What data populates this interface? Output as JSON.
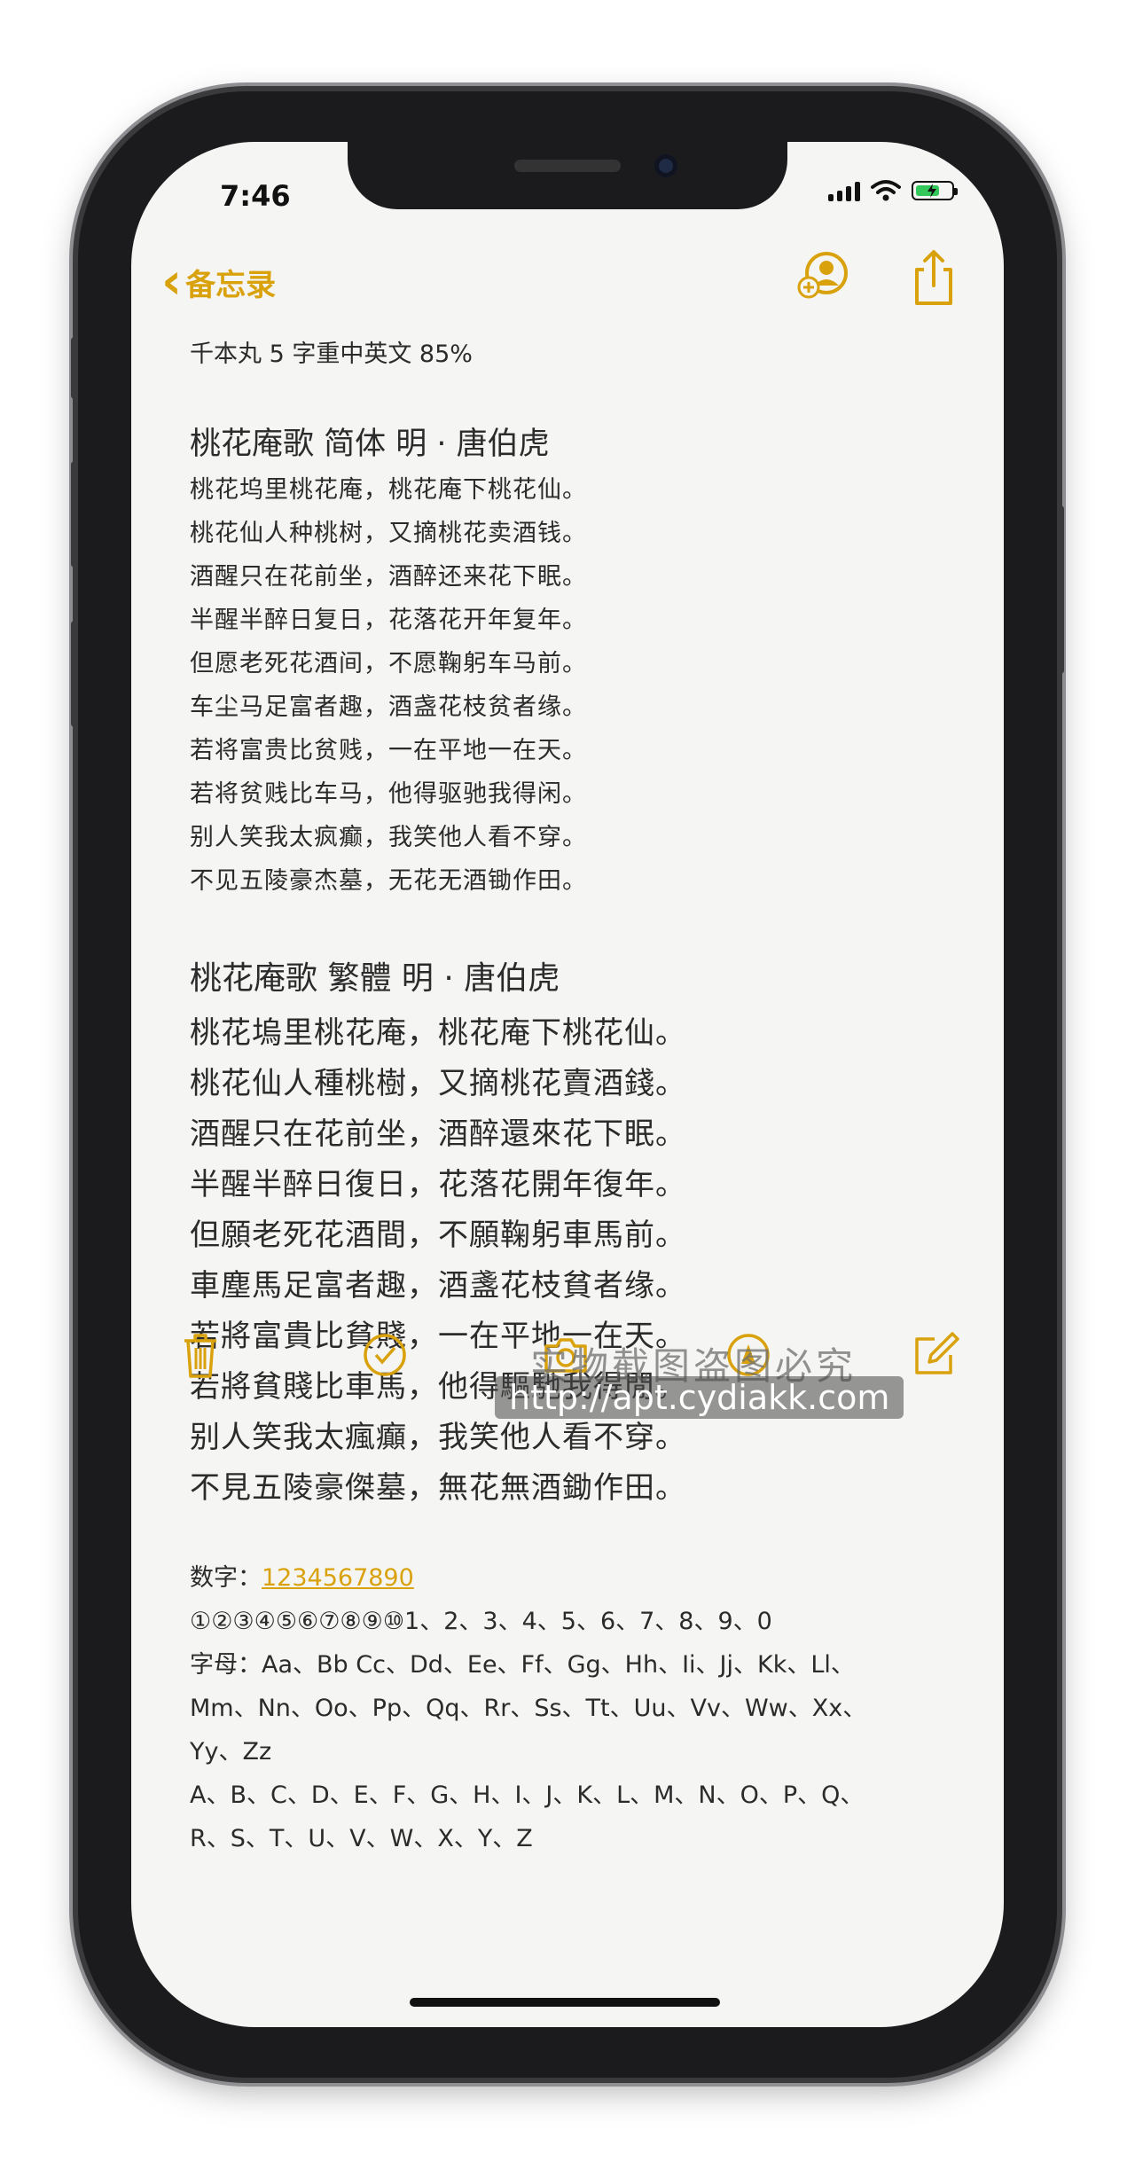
{
  "status_bar": {
    "time": "7:46"
  },
  "nav": {
    "back_label": "备忘录"
  },
  "note": {
    "subtitle": "千本丸 5 字重中英文 85%",
    "simplified": {
      "heading": "桃花庵歌  简体    明 · 唐伯虎",
      "lines": [
        "桃花坞里桃花庵，桃花庵下桃花仙。",
        "桃花仙人种桃树，又摘桃花卖酒钱。",
        "酒醒只在花前坐，酒醉还来花下眠。",
        "半醒半醉日复日，花落花开年复年。",
        "但愿老死花酒间，不愿鞠躬车马前。",
        "车尘马足富者趣，酒盏花枝贫者缘。",
        "若将富贵比贫贱，一在平地一在天。",
        "若将贫贱比车马，他得驱驰我得闲。",
        "别人笑我太疯癫，我笑他人看不穿。",
        "不见五陵豪杰墓，无花无酒锄作田。"
      ]
    },
    "traditional": {
      "heading": "桃花庵歌  繁體       明 · 唐伯虎",
      "lines": [
        "桃花塢里桃花庵，桃花庵下桃花仙。",
        "桃花仙人種桃樹，又摘桃花賣酒錢。",
        "酒醒只在花前坐，酒醉還來花下眠。",
        "半醒半醉日復日，花落花開年復年。",
        "但願老死花酒間，不願鞠躬車馬前。",
        "車塵馬足富者趣，酒盞花枝貧者缘。",
        "若將富貴比貧賤，一在平地一在天。",
        "若將貧賤比車馬，他得驅馳我得閒。",
        "别人笑我太瘋癲，我笑他人看不穿。",
        "不見五陵豪傑墓，無花無酒鋤作田。"
      ]
    },
    "digits_label": "数字：",
    "digits_link": "1234567890",
    "circled_line": "①②③④⑤⑥⑦⑧⑨⑩1、2、3、4、5、6、7、8、9、0",
    "letters_lines": [
      "字母：Aa、Bb Cc、Dd、Ee、Ff、Gg、Hh、Ii、Jj、Kk、Ll、",
      "Mm、Nn、Oo、Pp、Qq、Rr、Ss、Tt、Uu、Vv、Ww、Xx、",
      "Yy、Zz",
      "A、B、C、D、E、F、G、H、I、J、K、L、M、N、O、P、Q、",
      "R、S、T、U、V、W、X、Y、Z"
    ]
  },
  "watermark": {
    "line1": "实物截图盗图必究",
    "line2": "http://apt.cydiakk.com"
  },
  "colors": {
    "accent": "#d9a20d",
    "paper": "#f5f5f3",
    "text": "#2b2b2b"
  }
}
